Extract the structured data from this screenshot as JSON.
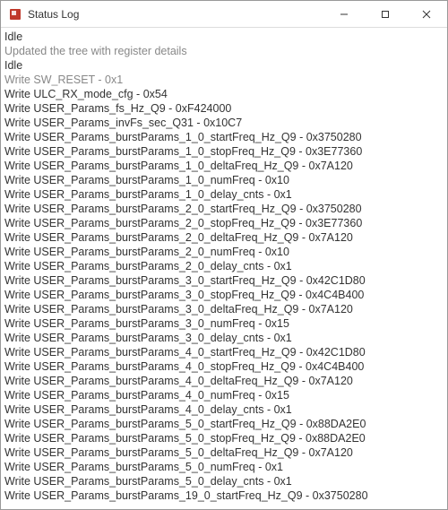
{
  "window": {
    "title": "Status Log",
    "minimize": "—",
    "maximize": "☐",
    "close": "✕"
  },
  "log": [
    {
      "text": "Idle",
      "gray": false
    },
    {
      "text": "Updated the tree with register details",
      "gray": true
    },
    {
      "text": "Idle",
      "gray": false
    },
    {
      "text": "Write SW_RESET - 0x1",
      "gray": true
    },
    {
      "text": "Write ULC_RX_mode_cfg - 0x54",
      "gray": false
    },
    {
      "text": "Write USER_Params_fs_Hz_Q9 - 0xF424000",
      "gray": false
    },
    {
      "text": "Write USER_Params_invFs_sec_Q31 - 0x10C7",
      "gray": false
    },
    {
      "text": "Write USER_Params_burstParams_1_0_startFreq_Hz_Q9 - 0x3750280",
      "gray": false
    },
    {
      "text": "Write USER_Params_burstParams_1_0_stopFreq_Hz_Q9 - 0x3E77360",
      "gray": false
    },
    {
      "text": "Write USER_Params_burstParams_1_0_deltaFreq_Hz_Q9 - 0x7A120",
      "gray": false
    },
    {
      "text": "Write USER_Params_burstParams_1_0_numFreq - 0x10",
      "gray": false
    },
    {
      "text": "Write USER_Params_burstParams_1_0_delay_cnts - 0x1",
      "gray": false
    },
    {
      "text": "Write USER_Params_burstParams_2_0_startFreq_Hz_Q9 - 0x3750280",
      "gray": false
    },
    {
      "text": "Write USER_Params_burstParams_2_0_stopFreq_Hz_Q9 - 0x3E77360",
      "gray": false
    },
    {
      "text": "Write USER_Params_burstParams_2_0_deltaFreq_Hz_Q9 - 0x7A120",
      "gray": false
    },
    {
      "text": "Write USER_Params_burstParams_2_0_numFreq - 0x10",
      "gray": false
    },
    {
      "text": "Write USER_Params_burstParams_2_0_delay_cnts - 0x1",
      "gray": false
    },
    {
      "text": "Write USER_Params_burstParams_3_0_startFreq_Hz_Q9 - 0x42C1D80",
      "gray": false
    },
    {
      "text": "Write USER_Params_burstParams_3_0_stopFreq_Hz_Q9 - 0x4C4B400",
      "gray": false
    },
    {
      "text": "Write USER_Params_burstParams_3_0_deltaFreq_Hz_Q9 - 0x7A120",
      "gray": false
    },
    {
      "text": "Write USER_Params_burstParams_3_0_numFreq - 0x15",
      "gray": false
    },
    {
      "text": "Write USER_Params_burstParams_3_0_delay_cnts - 0x1",
      "gray": false
    },
    {
      "text": "Write USER_Params_burstParams_4_0_startFreq_Hz_Q9 - 0x42C1D80",
      "gray": false
    },
    {
      "text": "Write USER_Params_burstParams_4_0_stopFreq_Hz_Q9 - 0x4C4B400",
      "gray": false
    },
    {
      "text": "Write USER_Params_burstParams_4_0_deltaFreq_Hz_Q9 - 0x7A120",
      "gray": false
    },
    {
      "text": "Write USER_Params_burstParams_4_0_numFreq - 0x15",
      "gray": false
    },
    {
      "text": "Write USER_Params_burstParams_4_0_delay_cnts - 0x1",
      "gray": false
    },
    {
      "text": "Write USER_Params_burstParams_5_0_startFreq_Hz_Q9 - 0x88DA2E0",
      "gray": false
    },
    {
      "text": "Write USER_Params_burstParams_5_0_stopFreq_Hz_Q9 - 0x88DA2E0",
      "gray": false
    },
    {
      "text": "Write USER_Params_burstParams_5_0_deltaFreq_Hz_Q9 - 0x7A120",
      "gray": false
    },
    {
      "text": "Write USER_Params_burstParams_5_0_numFreq - 0x1",
      "gray": false
    },
    {
      "text": "Write USER_Params_burstParams_5_0_delay_cnts - 0x1",
      "gray": false
    },
    {
      "text": "Write USER_Params_burstParams_19_0_startFreq_Hz_Q9 - 0x3750280",
      "gray": false
    }
  ]
}
